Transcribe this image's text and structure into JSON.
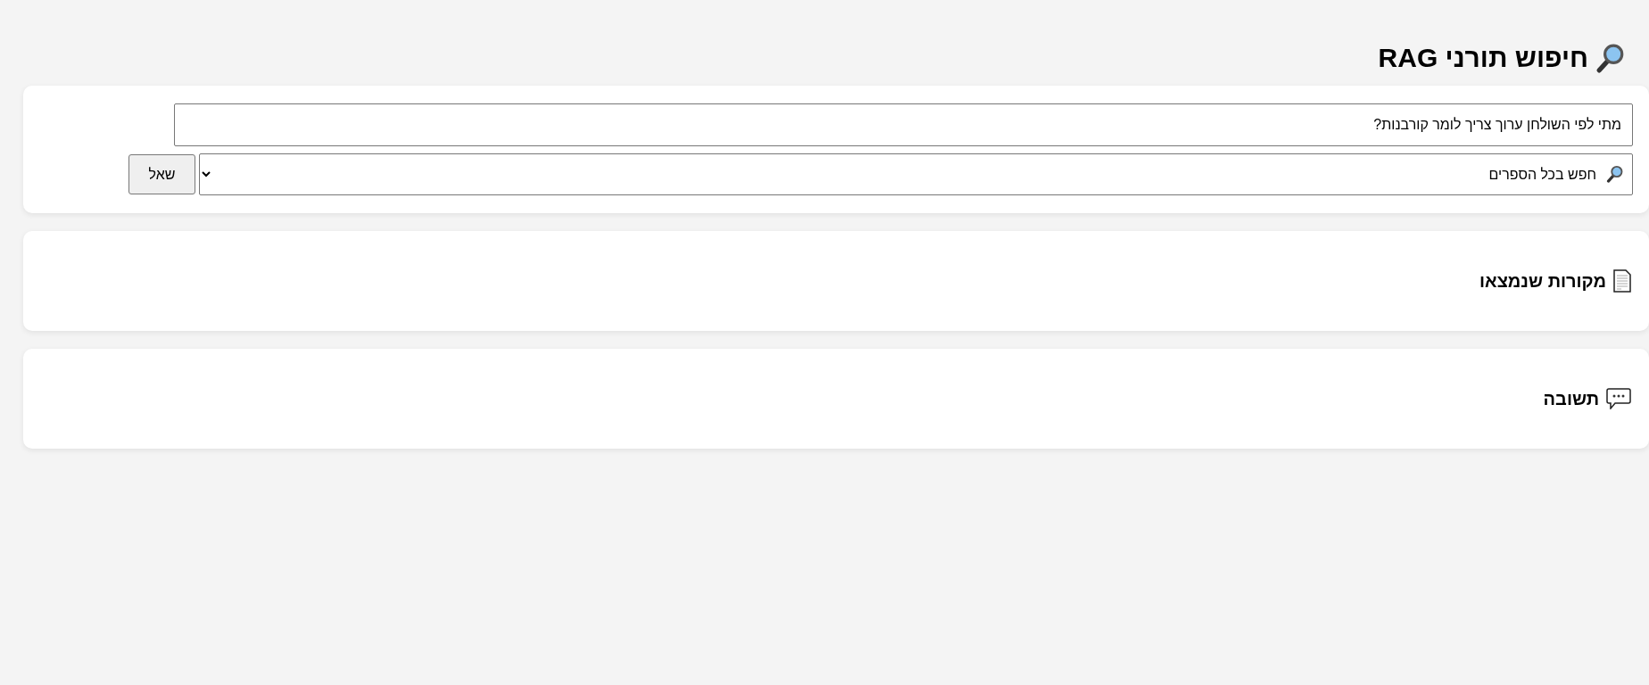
{
  "title": "חיפוש תורני RAG",
  "query": {
    "value": "מתי לפי השולחן ערוך צריך לומר קורבנות?"
  },
  "scope": {
    "value": "חפש בכל הספרים"
  },
  "ask_button": "שאל",
  "sections": [
    {
      "kind": "sources",
      "title": "מקורות שנמצאו"
    },
    {
      "kind": "answer",
      "title": "תשובה"
    }
  ]
}
